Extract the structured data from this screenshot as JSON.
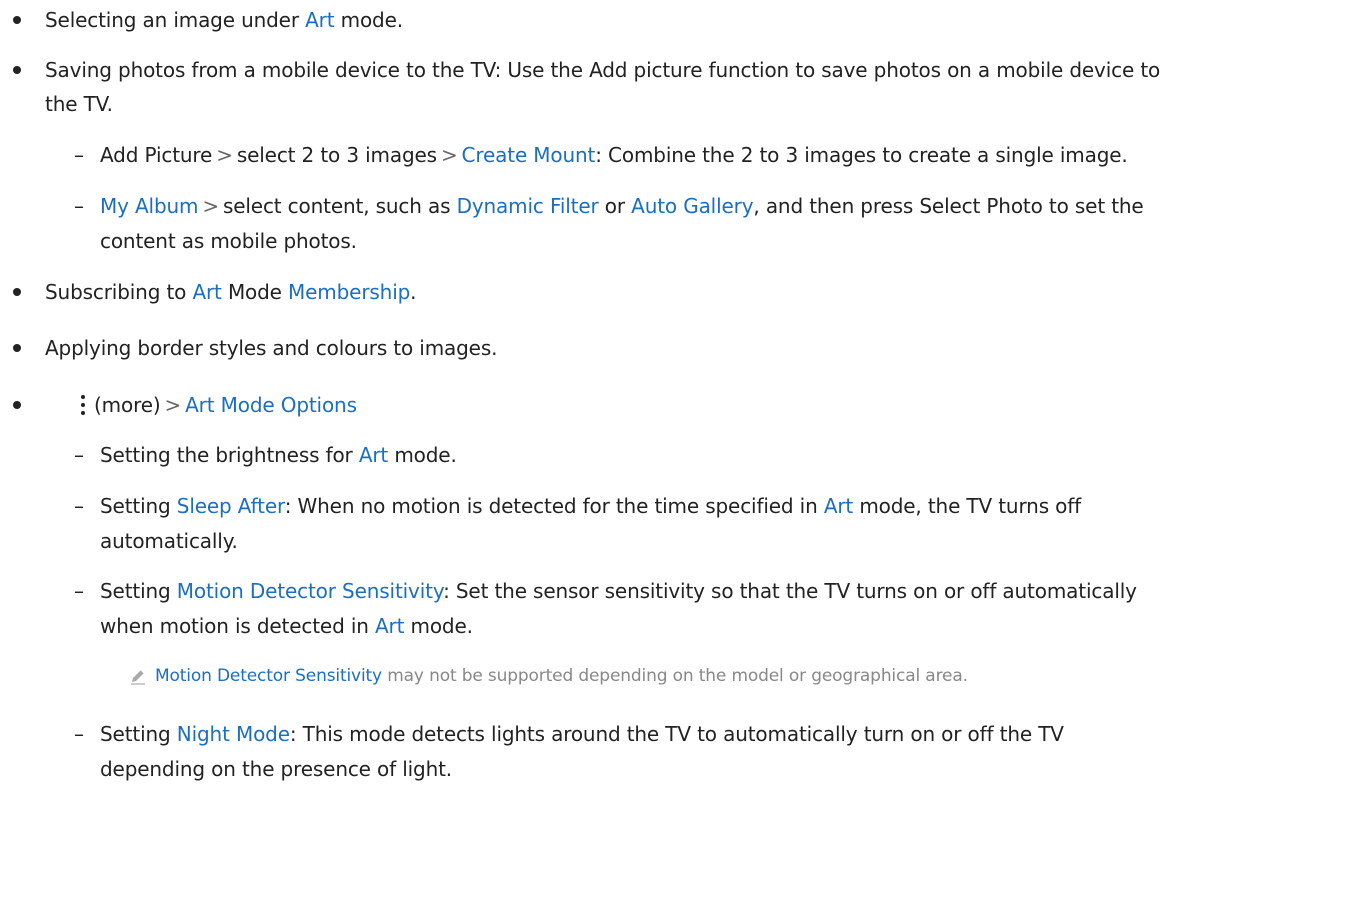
{
  "colors": {
    "link": "#1a6fc4",
    "text": "#222222",
    "note": "#888888"
  },
  "items": {
    "b1": {
      "a": "Selecting an image under ",
      "link": "Art",
      "b": " mode."
    },
    "b2": {
      "line1": "Saving photos from a mobile device to the TV: Use the Add picture function to save photos on a mobile device to",
      "line2": "the TV."
    },
    "s1": {
      "a": "Add Picture",
      "sep1": ">",
      "b": "select 2 to 3 images",
      "sep2": ">",
      "link": "Create Mount",
      "c": ": Combine the 2 to 3 images to create a single image."
    },
    "s2": {
      "link1": "My Album",
      "sep": ">",
      "a": "select content, such as ",
      "link2": "Dynamic Filter",
      "b": " or ",
      "link3": "Auto Gallery",
      "c": ", and then press Select Photo to set the",
      "line2": "content as mobile photos."
    },
    "b3": {
      "a": "Subscribing to ",
      "link1": "Art",
      "b": " Mode ",
      "link2": "Membership",
      "c": "."
    },
    "b4": {
      "text": "Applying border styles and colours to images."
    },
    "b5": {
      "icon": "more-vertical-icon",
      "a": "(more)",
      "sep": ">",
      "link": "Art Mode Options"
    },
    "s3": {
      "a": "Setting the brightness for ",
      "link": "Art",
      "b": " mode."
    },
    "s4": {
      "a": "Setting ",
      "link1": "Sleep After",
      "b": ": When no motion is detected for the time specified in ",
      "link2": "Art",
      "c": " mode, the TV turns off",
      "line2": "automatically."
    },
    "s5": {
      "a": "Setting ",
      "link1": "Motion Detector Sensitivity",
      "b": ": Set the sensor sensitivity so that the TV turns on or off automatically",
      "line2a": "when motion is detected in ",
      "link2": "Art",
      "line2b": " mode."
    },
    "note1": {
      "icon": "pencil-icon",
      "link": "Motion Detector Sensitivity",
      "text": " may not be supported depending on the model or geographical area."
    },
    "s6": {
      "a": "Setting ",
      "link": "Night Mode",
      "b": ": This mode detects lights around the TV to automatically turn on or off the TV",
      "line2": "depending on the presence of light."
    },
    "dash": "–"
  }
}
